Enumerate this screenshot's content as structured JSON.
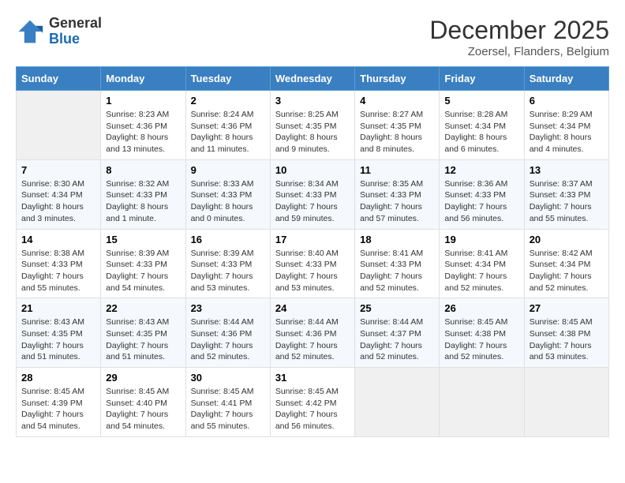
{
  "header": {
    "logo_line1": "General",
    "logo_line2": "Blue",
    "month": "December 2025",
    "location": "Zoersel, Flanders, Belgium"
  },
  "days_of_week": [
    "Sunday",
    "Monday",
    "Tuesday",
    "Wednesday",
    "Thursday",
    "Friday",
    "Saturday"
  ],
  "weeks": [
    [
      {
        "num": "",
        "empty": true
      },
      {
        "num": "1",
        "sunrise": "Sunrise: 8:23 AM",
        "sunset": "Sunset: 4:36 PM",
        "daylight": "Daylight: 8 hours and 13 minutes."
      },
      {
        "num": "2",
        "sunrise": "Sunrise: 8:24 AM",
        "sunset": "Sunset: 4:36 PM",
        "daylight": "Daylight: 8 hours and 11 minutes."
      },
      {
        "num": "3",
        "sunrise": "Sunrise: 8:25 AM",
        "sunset": "Sunset: 4:35 PM",
        "daylight": "Daylight: 8 hours and 9 minutes."
      },
      {
        "num": "4",
        "sunrise": "Sunrise: 8:27 AM",
        "sunset": "Sunset: 4:35 PM",
        "daylight": "Daylight: 8 hours and 8 minutes."
      },
      {
        "num": "5",
        "sunrise": "Sunrise: 8:28 AM",
        "sunset": "Sunset: 4:34 PM",
        "daylight": "Daylight: 8 hours and 6 minutes."
      },
      {
        "num": "6",
        "sunrise": "Sunrise: 8:29 AM",
        "sunset": "Sunset: 4:34 PM",
        "daylight": "Daylight: 8 hours and 4 minutes."
      }
    ],
    [
      {
        "num": "7",
        "sunrise": "Sunrise: 8:30 AM",
        "sunset": "Sunset: 4:34 PM",
        "daylight": "Daylight: 8 hours and 3 minutes."
      },
      {
        "num": "8",
        "sunrise": "Sunrise: 8:32 AM",
        "sunset": "Sunset: 4:33 PM",
        "daylight": "Daylight: 8 hours and 1 minute."
      },
      {
        "num": "9",
        "sunrise": "Sunrise: 8:33 AM",
        "sunset": "Sunset: 4:33 PM",
        "daylight": "Daylight: 8 hours and 0 minutes."
      },
      {
        "num": "10",
        "sunrise": "Sunrise: 8:34 AM",
        "sunset": "Sunset: 4:33 PM",
        "daylight": "Daylight: 7 hours and 59 minutes."
      },
      {
        "num": "11",
        "sunrise": "Sunrise: 8:35 AM",
        "sunset": "Sunset: 4:33 PM",
        "daylight": "Daylight: 7 hours and 57 minutes."
      },
      {
        "num": "12",
        "sunrise": "Sunrise: 8:36 AM",
        "sunset": "Sunset: 4:33 PM",
        "daylight": "Daylight: 7 hours and 56 minutes."
      },
      {
        "num": "13",
        "sunrise": "Sunrise: 8:37 AM",
        "sunset": "Sunset: 4:33 PM",
        "daylight": "Daylight: 7 hours and 55 minutes."
      }
    ],
    [
      {
        "num": "14",
        "sunrise": "Sunrise: 8:38 AM",
        "sunset": "Sunset: 4:33 PM",
        "daylight": "Daylight: 7 hours and 55 minutes."
      },
      {
        "num": "15",
        "sunrise": "Sunrise: 8:39 AM",
        "sunset": "Sunset: 4:33 PM",
        "daylight": "Daylight: 7 hours and 54 minutes."
      },
      {
        "num": "16",
        "sunrise": "Sunrise: 8:39 AM",
        "sunset": "Sunset: 4:33 PM",
        "daylight": "Daylight: 7 hours and 53 minutes."
      },
      {
        "num": "17",
        "sunrise": "Sunrise: 8:40 AM",
        "sunset": "Sunset: 4:33 PM",
        "daylight": "Daylight: 7 hours and 53 minutes."
      },
      {
        "num": "18",
        "sunrise": "Sunrise: 8:41 AM",
        "sunset": "Sunset: 4:33 PM",
        "daylight": "Daylight: 7 hours and 52 minutes."
      },
      {
        "num": "19",
        "sunrise": "Sunrise: 8:41 AM",
        "sunset": "Sunset: 4:34 PM",
        "daylight": "Daylight: 7 hours and 52 minutes."
      },
      {
        "num": "20",
        "sunrise": "Sunrise: 8:42 AM",
        "sunset": "Sunset: 4:34 PM",
        "daylight": "Daylight: 7 hours and 52 minutes."
      }
    ],
    [
      {
        "num": "21",
        "sunrise": "Sunrise: 8:43 AM",
        "sunset": "Sunset: 4:35 PM",
        "daylight": "Daylight: 7 hours and 51 minutes."
      },
      {
        "num": "22",
        "sunrise": "Sunrise: 8:43 AM",
        "sunset": "Sunset: 4:35 PM",
        "daylight": "Daylight: 7 hours and 51 minutes."
      },
      {
        "num": "23",
        "sunrise": "Sunrise: 8:44 AM",
        "sunset": "Sunset: 4:36 PM",
        "daylight": "Daylight: 7 hours and 52 minutes."
      },
      {
        "num": "24",
        "sunrise": "Sunrise: 8:44 AM",
        "sunset": "Sunset: 4:36 PM",
        "daylight": "Daylight: 7 hours and 52 minutes."
      },
      {
        "num": "25",
        "sunrise": "Sunrise: 8:44 AM",
        "sunset": "Sunset: 4:37 PM",
        "daylight": "Daylight: 7 hours and 52 minutes."
      },
      {
        "num": "26",
        "sunrise": "Sunrise: 8:45 AM",
        "sunset": "Sunset: 4:38 PM",
        "daylight": "Daylight: 7 hours and 52 minutes."
      },
      {
        "num": "27",
        "sunrise": "Sunrise: 8:45 AM",
        "sunset": "Sunset: 4:38 PM",
        "daylight": "Daylight: 7 hours and 53 minutes."
      }
    ],
    [
      {
        "num": "28",
        "sunrise": "Sunrise: 8:45 AM",
        "sunset": "Sunset: 4:39 PM",
        "daylight": "Daylight: 7 hours and 54 minutes."
      },
      {
        "num": "29",
        "sunrise": "Sunrise: 8:45 AM",
        "sunset": "Sunset: 4:40 PM",
        "daylight": "Daylight: 7 hours and 54 minutes."
      },
      {
        "num": "30",
        "sunrise": "Sunrise: 8:45 AM",
        "sunset": "Sunset: 4:41 PM",
        "daylight": "Daylight: 7 hours and 55 minutes."
      },
      {
        "num": "31",
        "sunrise": "Sunrise: 8:45 AM",
        "sunset": "Sunset: 4:42 PM",
        "daylight": "Daylight: 7 hours and 56 minutes."
      },
      {
        "num": "",
        "empty": true
      },
      {
        "num": "",
        "empty": true
      },
      {
        "num": "",
        "empty": true
      }
    ]
  ]
}
